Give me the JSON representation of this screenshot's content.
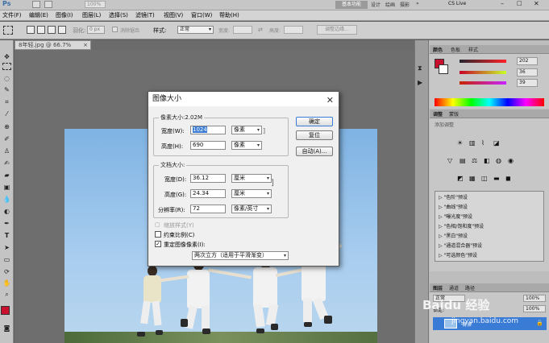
{
  "app": {
    "logo": "Ps",
    "workspace_label": "基本功能",
    "cs_live": "CS Live"
  },
  "menu": [
    "文件(F)",
    "编辑(E)",
    "图像(I)",
    "图层(L)",
    "选择(S)",
    "滤镜(T)",
    "视图(V)",
    "窗口(W)",
    "帮助(H)"
  ],
  "options": {
    "feather_value": "0 px",
    "antialias_label": "消除锯齿",
    "style_label": "样式:",
    "style_value": "正常",
    "width_label": "宽度:",
    "height_label": "高度:",
    "refine_edge": "调整边缘..."
  },
  "document": {
    "tab_title": "8年轻.jpg @ 66.7%(RGB/8)"
  },
  "panels": {
    "top_tabs": [
      "颜色",
      "色板",
      "样式"
    ],
    "color_values": [
      "202",
      "36",
      "39"
    ],
    "adjust_tabs": [
      "调整",
      "蒙版"
    ],
    "adjust_header": "添加调整",
    "presets": [
      "\"色阶\"预设",
      "\"曲线\"预设",
      "\"曝光度\"预设",
      "\"色相/饱和度\"预设",
      "\"黑白\"预设",
      "\"通道混合器\"预设",
      "\"可选颜色\"预设"
    ],
    "layer_tabs": [
      "图层",
      "通道",
      "路径"
    ],
    "blend_mode": "正常",
    "opacity": "100%",
    "lock_label": "锁定:",
    "fill": "100%",
    "layer_name": "背景"
  },
  "dialog": {
    "title": "图像大小",
    "pixel_dims_label": "像素大小:2.02M",
    "width_label": "宽度(W):",
    "width_value": "1024",
    "width_unit": "像素",
    "height_label": "高度(H):",
    "height_value": "690",
    "height_unit": "像素",
    "doc_size_label": "文档大小:",
    "doc_width_label": "宽度(D):",
    "doc_width_value": "36.12",
    "doc_width_unit": "厘米",
    "doc_height_label": "高度(G):",
    "doc_height_value": "24.34",
    "doc_height_unit": "厘米",
    "resolution_label": "分辨率(R):",
    "resolution_value": "72",
    "resolution_unit": "像素/英寸",
    "scale_styles_label": "缩放样式(Y)",
    "constrain_label": "约束比例(C)",
    "resample_label": "重定图像像素(I):",
    "resample_method": "两次立方（适用于平滑渐变）",
    "ok_label": "确定",
    "reset_label": "复位",
    "auto_label": "自动(A)..."
  },
  "watermark": "Baidu 经验",
  "watermark_url": "jingyan.baidu.com"
}
